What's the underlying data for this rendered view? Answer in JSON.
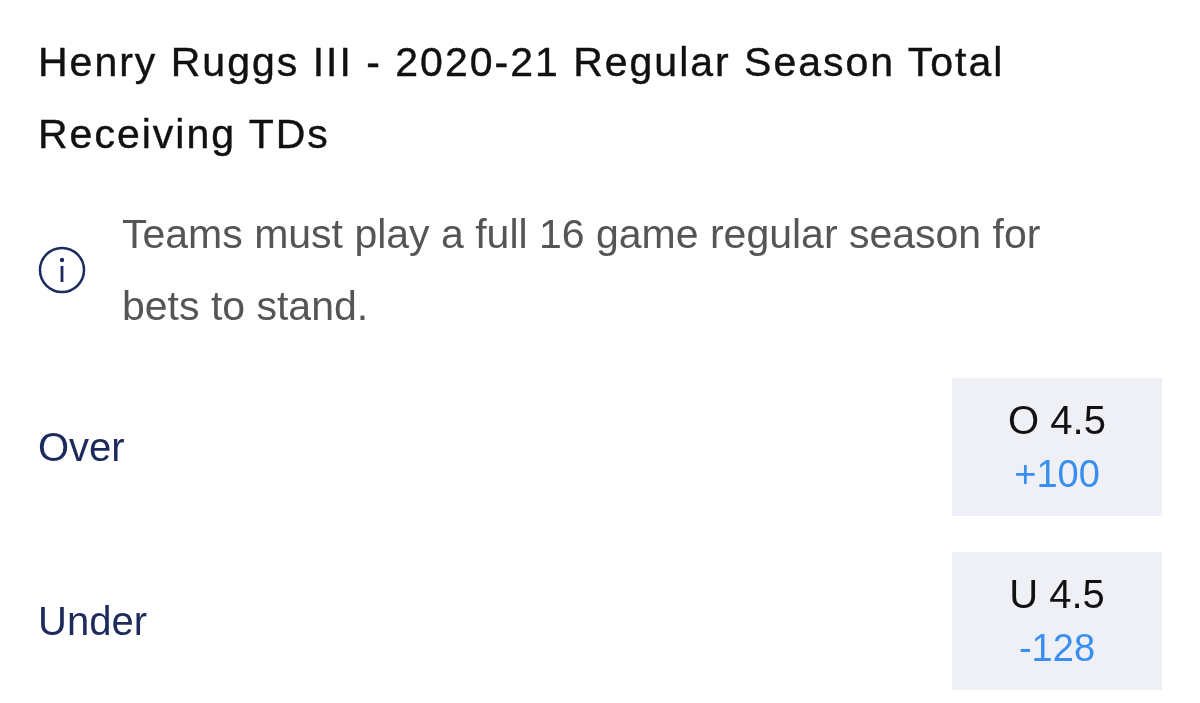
{
  "title": "Henry Ruggs III - 2020-21 Regular Season Total Receiving TDs",
  "notice": {
    "text": "Teams must play a full 16 game regular season for bets to stand."
  },
  "outcomes": [
    {
      "label": "Over",
      "line": "O 4.5",
      "odds": "+100"
    },
    {
      "label": "Under",
      "line": "U 4.5",
      "odds": "-128"
    }
  ]
}
